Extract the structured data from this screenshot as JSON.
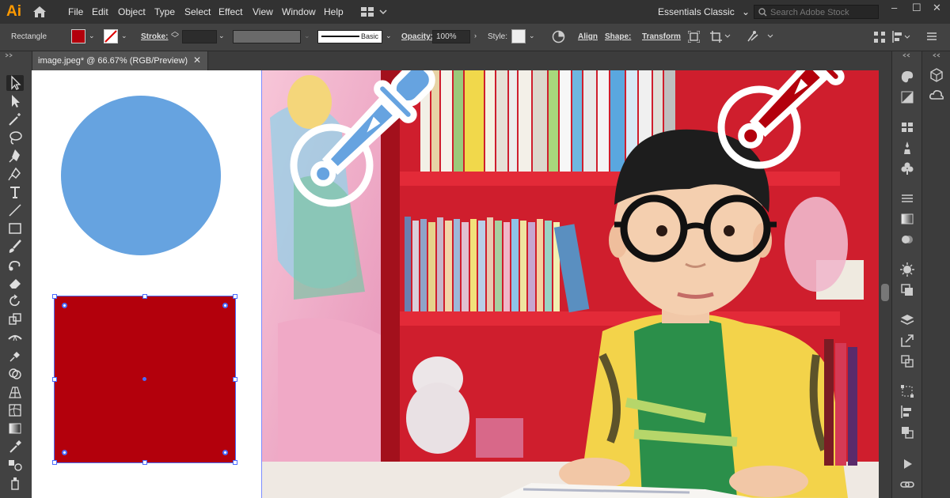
{
  "app": {
    "logo": "Ai",
    "home_icon": "home-icon"
  },
  "menu": [
    "File",
    "Edit",
    "Object",
    "Type",
    "Select",
    "Effect",
    "View",
    "Window",
    "Help"
  ],
  "workspace": {
    "label": "Essentials Classic"
  },
  "search": {
    "placeholder": "Search Adobe Stock"
  },
  "window_controls": [
    "–",
    "☐",
    "✕"
  ],
  "control_bar": {
    "object_type": "Rectangle",
    "fill_color": "#b3000c",
    "stroke_label": "Stroke:",
    "brush_label": "Basic",
    "opacity_label": "Opacity:",
    "opacity_value": "100%",
    "style_label": "Style:",
    "align_label": "Align",
    "shape_label": "Shape:",
    "transform_label": "Transform"
  },
  "document_tab": {
    "title": "image.jpeg* @ 66.67% (RGB/Preview)",
    "close": "✕"
  },
  "artwork": {
    "circle_color": "#66a3e0",
    "rect_color": "#b3000c"
  },
  "colors": {
    "blue_eyedropper": "#66a3e0",
    "red_eyedropper": "#b3000c",
    "selection": "#4a6bff"
  }
}
